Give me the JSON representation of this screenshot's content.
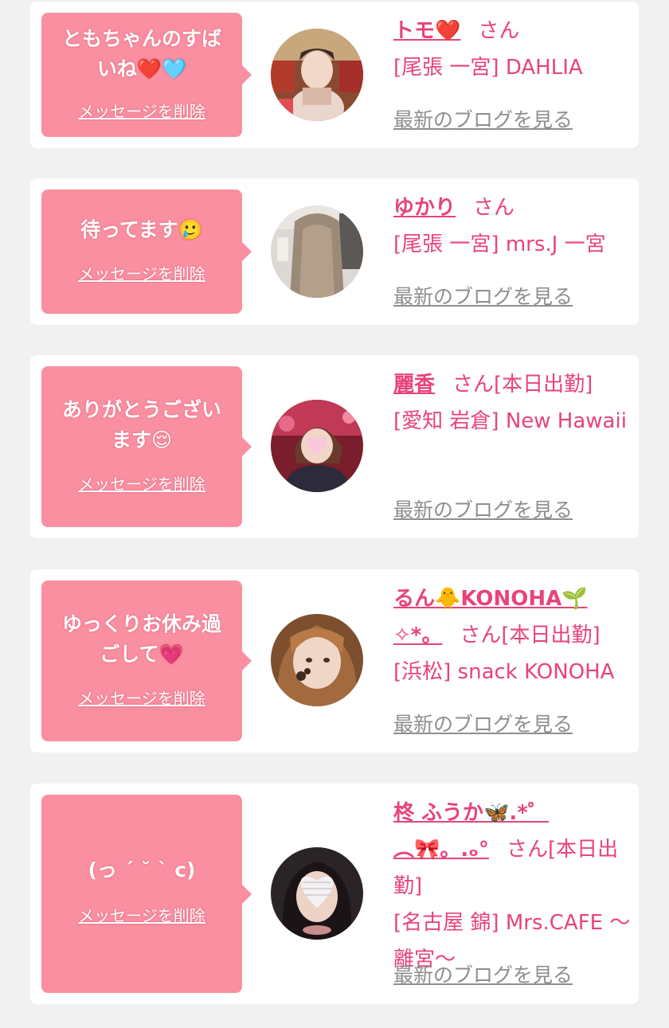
{
  "messages": [
    {
      "message": "ともちゃんのすばいね❤️🩵",
      "delete_label": "メッセージを削除",
      "name": "トモ❤️",
      "honorific": "さん",
      "status": "",
      "location": "[尾張 一宮] DAHLIA",
      "blog_label": "最新のブログを見る"
    },
    {
      "message": "待ってます🥲",
      "delete_label": "メッセージを削除",
      "name": "ゆかり",
      "honorific": "さん",
      "status": "",
      "location": "[尾張 一宮] mrs.J 一宮",
      "blog_label": "最新のブログを見る"
    },
    {
      "message": "ありがとうございます😌",
      "delete_label": "メッセージを削除",
      "name": "麗香",
      "honorific": "さん",
      "status": "[本日出勤]",
      "location": "[愛知 岩倉] New Hawaii",
      "blog_label": "最新のブログを見る"
    },
    {
      "message": "ゆっくりお休み過ごして💗",
      "delete_label": "メッセージを削除",
      "name": "るん🐥KONOHA🌱✧*。",
      "honorific": "さん",
      "status": "[本日出勤]",
      "location": "[浜松] snack KONOHA",
      "blog_label": "最新のブログを見る"
    },
    {
      "message": "(っ ´ ˘ ` c)",
      "delete_label": "メッセージを削除",
      "name": "柊 ふうか🦋.*゜︵🎀。.ₒ°",
      "honorific": "さん",
      "status": "[本日出勤]",
      "location": "[名古屋 錦] Mrs.CAFE 〜離宮〜",
      "blog_label": "最新のブログを見る"
    }
  ],
  "colors": {
    "accent": "#e8437a",
    "bubble": "#f98fa0",
    "link_gray": "#8e8e8e",
    "background": "#f1f1f1"
  }
}
